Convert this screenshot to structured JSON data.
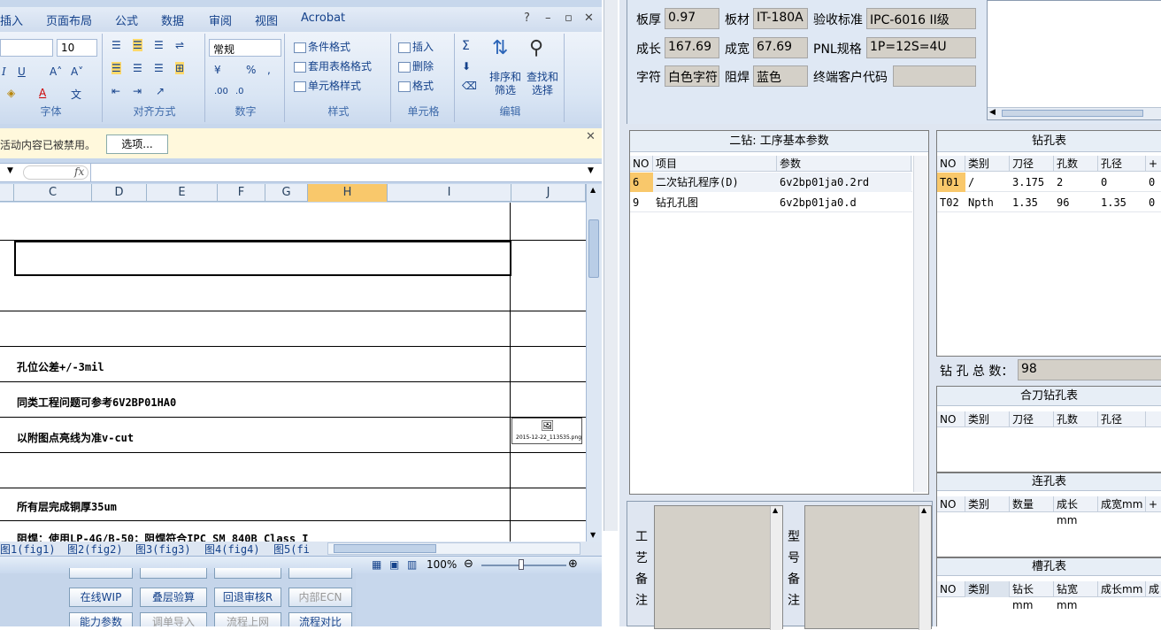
{
  "excel": {
    "tabs": [
      "插入",
      "页面布局",
      "公式",
      "数据",
      "审阅",
      "视图",
      "Acrobat"
    ],
    "font_size": "10",
    "number_format": "常规",
    "groups": [
      "字体",
      "对齐方式",
      "数字",
      "样式",
      "单元格",
      "编辑"
    ],
    "styles_items": [
      "条件格式",
      "套用表格格式",
      "单元格样式"
    ],
    "cells_items": [
      "插入",
      "删除",
      "格式"
    ],
    "edit_items": [
      "排序和筛选",
      "查找和选择"
    ],
    "security_msg": "活动内容已被禁用。",
    "options_label": "选项...",
    "fx": "fx",
    "columns": [
      "C",
      "D",
      "E",
      "F",
      "G",
      "H",
      "I",
      "J"
    ],
    "rows": [
      "",
      "",
      "",
      "",
      "孔位公差+/-3mil",
      "同类工程问题可参考6V2BP01HA0",
      "以附图点亮线为准v-cut",
      "",
      "所有层完成铜厚35um",
      "阻焊：使用LP-4G/B-50；阻焊符合IPC SM 840B Class I"
    ],
    "attachment": "2015-12-22_113535.png",
    "sheet_tabs": [
      "图1(fig1)",
      "图2(fig2)",
      "图3(fig3)",
      "图4(fig4)",
      "图5(fi"
    ],
    "zoom": "100%",
    "bottom_buttons": [
      "在线WIP",
      "叠层验算",
      "回退审核R",
      "内部ECN",
      "能力参数",
      "调单导入",
      "流程上网",
      "流程对比"
    ]
  },
  "info": {
    "thickness_label": "板厚",
    "thickness": "0.97",
    "material_label": "板材",
    "material": "IT-180A",
    "standard_label": "验收标准",
    "standard": "IPC-6016 II级",
    "length_label": "成长",
    "length": "167.69",
    "width_label": "成宽",
    "width": "67.69",
    "pnl_label": "PNL规格",
    "pnl": "1P=12S=4U",
    "legend_label": "字符",
    "legend": "白色字符",
    "mask_label": "阻焊",
    "mask": "蓝色",
    "customer_label": "终端客户代码",
    "customer": ""
  },
  "drill2": {
    "title": "二钻: 工序基本参数",
    "headers": [
      "NO",
      "项目",
      "参数"
    ],
    "rows": [
      [
        "6",
        "二次钻孔程序(D)",
        "6v2bp01ja0.2rd"
      ],
      [
        "9",
        "钻孔孔图",
        "6v2bp01ja0.d"
      ]
    ]
  },
  "drilltable": {
    "title": "钻孔表",
    "headers": [
      "NO",
      "类别",
      "刀径",
      "孔数",
      "孔径",
      "+"
    ],
    "rows": [
      [
        "T01",
        "/",
        "3.175",
        "2",
        "0",
        "0"
      ],
      [
        "T02",
        "Npth",
        "1.35",
        "96",
        "1.35",
        "0"
      ]
    ],
    "total_label": "钻 孔 总 数：",
    "total": "98"
  },
  "combined": {
    "title": "合刀钻孔表",
    "headers": [
      "NO",
      "类别",
      "刀径",
      "孔数",
      "孔径"
    ]
  },
  "slot_link": {
    "title": "连孔表",
    "headers": [
      "NO",
      "类别",
      "数量",
      "成长mm",
      "成宽mm",
      "+"
    ]
  },
  "slot": {
    "title": "槽孔表",
    "headers": [
      "NO",
      "类别",
      "钻长mm",
      "钻宽mm",
      "成长mm",
      "成宽"
    ]
  },
  "memo": {
    "process": "工艺备注",
    "model": "型号备注"
  }
}
